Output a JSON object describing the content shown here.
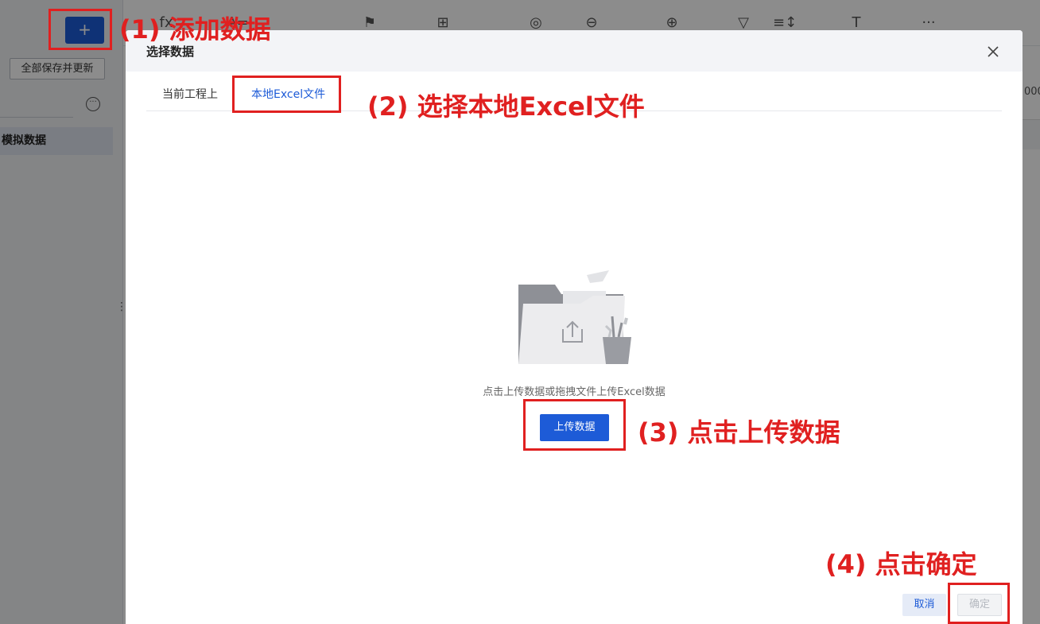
{
  "sidebar": {
    "add_label": "+",
    "save_all_label": "全部保存并更新",
    "more_label": "···",
    "dataset_item": "模拟数据",
    "drag_handle": "⋮⋮"
  },
  "toolbar": {
    "icons": [
      "fx",
      "⊟",
      "A=",
      "⚑",
      "⊞",
      "◎",
      "⊖",
      "⊕",
      "▽",
      "≡↕",
      "T",
      "···"
    ]
  },
  "right_stub": {
    "value": "000"
  },
  "modal": {
    "title": "选择数据",
    "close_label": "✕",
    "tabs": [
      {
        "label": "当前工程上",
        "active": false
      },
      {
        "label": "本地Excel文件",
        "active": true
      }
    ],
    "upload_hint": "点击上传数据或拖拽文件上传Excel数据",
    "upload_button": "上传数据",
    "cancel_button": "取消",
    "confirm_button": "确定"
  },
  "annotations": {
    "step1": "(1) 添加数据",
    "step2": "(2) 选择本地Excel文件",
    "step3": "(3) 点击上传数据",
    "step4": "(4) 点击确定",
    "color": "#e02020"
  },
  "colors": {
    "primary": "#1d5bd7",
    "annotation": "#e02020"
  }
}
